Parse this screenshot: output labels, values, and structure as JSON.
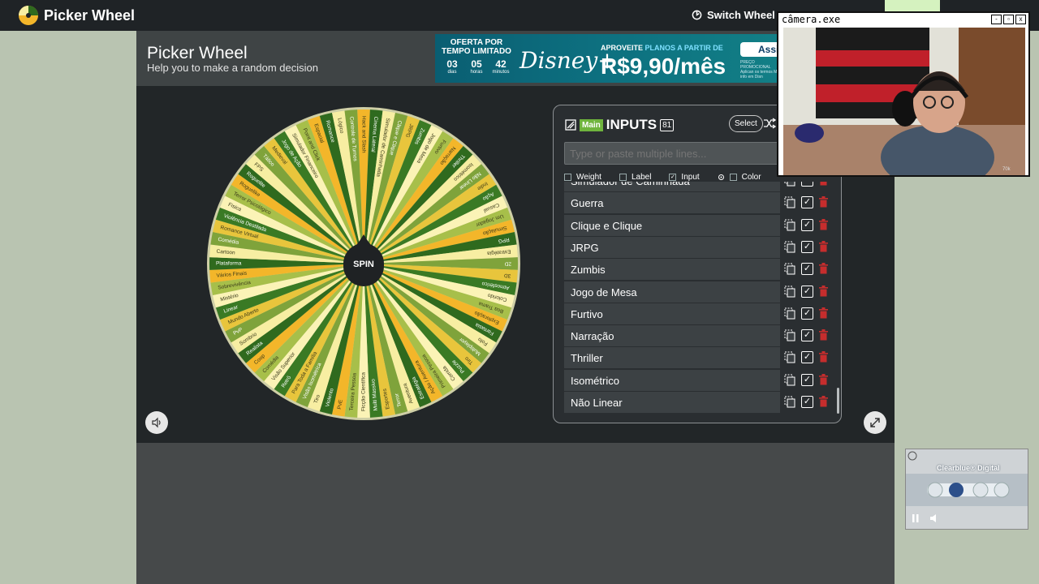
{
  "app": {
    "name": "Picker Wheel",
    "switch_label": "Switch Wheel"
  },
  "page": {
    "title": "Picker Wheel",
    "subtitle": "Help you to make a random decision"
  },
  "ad": {
    "offer": "OFERTA POR TEMPO LIMITADO",
    "timer": {
      "days": "03",
      "hours": "05",
      "minutes": "42",
      "days_label": "dias",
      "hours_label": "horas",
      "minutes_label": "minutos"
    },
    "brand": "Disney+",
    "aproveite": "APROVEITE",
    "aproveite_accent": "PLANOS A PARTIR DE",
    "price": "R$9,90/mês",
    "button": "Assin",
    "fine_print": "PREÇO PROMOCIONAL Aplican os termos Mais info em Disn"
  },
  "wheel": {
    "spin_label": "SPIN",
    "colors": [
      "#f3b62a",
      "#2f6a1e",
      "#f7eea2",
      "#7fa33b",
      "#e8c53c",
      "#3a7a24",
      "#fbf3b6",
      "#a7bf4a"
    ],
    "segments": [
      "Hack and Slash",
      "Cinema Lateral",
      "Simulador de Caminhada",
      "Clique e Clique",
      "JRPG",
      "Zumbis",
      "Jogo de Mesa",
      "Furtivo",
      "Narração",
      "Thriller",
      "Isométrico",
      "Não Linear",
      "Indie",
      "Ação",
      "Casual",
      "Um Jogador",
      "Simulação",
      "RPG",
      "Estratégia",
      "2D",
      "3D",
      "Atmosférico",
      "Colorido",
      "Boa Trama",
      "Exploração",
      "Fantasia",
      "Fofo",
      "Multiplayer",
      "Tiro",
      "Puzzle",
      "Corrida",
      "Primeira Pessoa",
      "Ação / Aventura",
      "Estratégia",
      "Aventura",
      "Terror",
      "Esportes",
      "Multi Massivo",
      "Ficção Científica",
      "Terceira Pessoa",
      "PvE",
      "Violento",
      "Tiro",
      "Visão Isométrica",
      "Para Toda a Família",
      "Retrô",
      "Visão Superior",
      "Comédia",
      "Coop",
      "Realista",
      "Sombrio",
      "PvP",
      "Mundo Aberto",
      "Linear",
      "Mistério",
      "Sobrevivência",
      "Vários Finais",
      "Plataforma",
      "Cartoon",
      "Comédia",
      "Romance Virtual",
      "Violência Destilada",
      "Fisica",
      "Terror Psicológico",
      "Roguelike",
      "Roguelite",
      "FPS",
      "Tático",
      "Medieval",
      "Jogo de Ação",
      "Simulador Financeiro",
      "Point and Click",
      "Espacial",
      "Romance",
      "Lógico",
      "Controle de Turnos"
    ]
  },
  "inputs": {
    "tab": "Main",
    "title": "INPUTS",
    "count": "81",
    "select_label": "Select",
    "placeholder": "Type or paste multiple lines...",
    "options": {
      "weight": "Weight",
      "label": "Label",
      "input": "Input",
      "color": "Color"
    },
    "items": [
      "Simulador de Caminhada",
      "Guerra",
      "Clique e Clique",
      "JRPG",
      "Zumbis",
      "Jogo de Mesa",
      "Furtivo",
      "Narração",
      "Thriller",
      "Isométrico",
      "Não Linear"
    ]
  },
  "camera": {
    "title": "câmera.exe",
    "buttons": [
      "-",
      "▫",
      "x"
    ],
    "timestamp": "70k"
  },
  "video_ad": {
    "title": "Clearblue® Digital"
  }
}
